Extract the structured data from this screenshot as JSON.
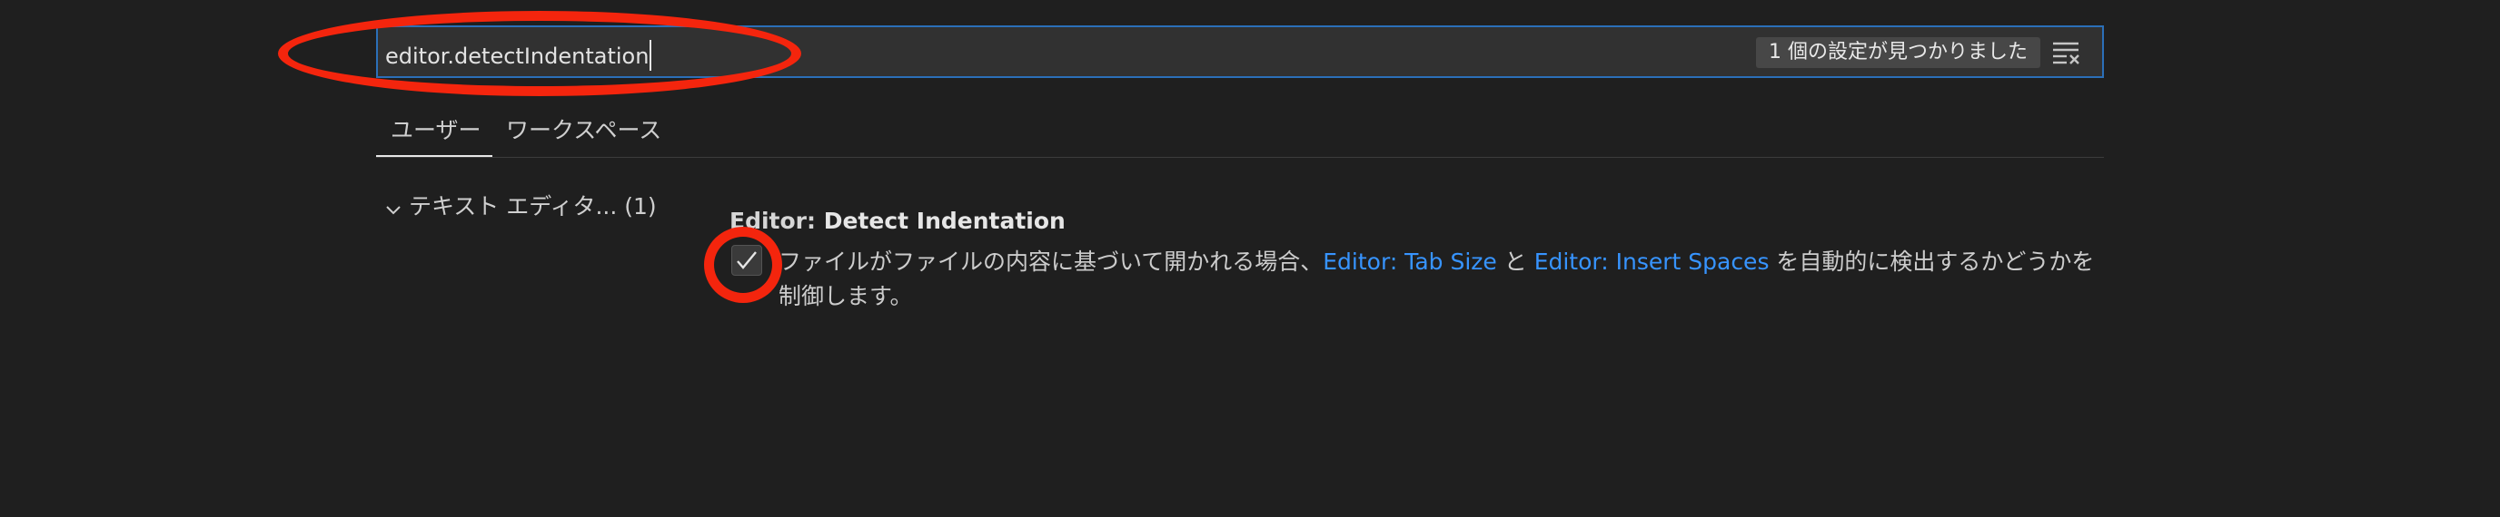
{
  "search": {
    "value": "editor.detectIndentation",
    "results_label": "1 個の設定が見つかりました",
    "clear_icon": "clear-filter-icon"
  },
  "tabs": [
    {
      "label": "ユーザー",
      "active": true
    },
    {
      "label": "ワークスペース",
      "active": false
    }
  ],
  "toc": {
    "item_label": "テキスト エディタ...",
    "item_count": "(1)",
    "expand_icon": "chevron-down-icon"
  },
  "setting": {
    "title_category": "Editor: ",
    "title_name": "Detect Indentation",
    "checked": true,
    "description_before": "ファイルがファイルの内容に基づいて開かれる場合、",
    "link_tab_size": "Editor: Tab Size",
    "description_and": " と ",
    "link_insert_spaces": "Editor: Insert Spaces",
    "description_after": " を自動的に検出するかどうかを制御します。"
  },
  "colors": {
    "background": "#1f1f1f",
    "search_border": "#2b6fb8",
    "link": "#3794ff",
    "annotation": "#f4250d"
  }
}
